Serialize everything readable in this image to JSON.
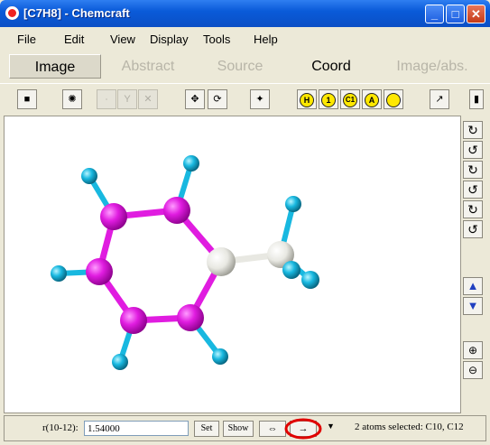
{
  "window": {
    "title": "[C7H8] - Chemcraft"
  },
  "menu": [
    "File",
    "Edit",
    "View",
    "Display",
    "Tools",
    "Help"
  ],
  "tabs": [
    {
      "label": "Image",
      "active": true,
      "selected": true
    },
    {
      "label": "Abstract",
      "active": false
    },
    {
      "label": "Source",
      "active": false
    },
    {
      "label": "Coord",
      "active": true
    },
    {
      "label": "Image/abs.",
      "active": false
    }
  ],
  "toolbar": {
    "atom_buttons": [
      "H",
      "1",
      "C1",
      "A"
    ]
  },
  "status": {
    "distance_label": "r(10-12):",
    "distance_value": "1.54000",
    "set_label": "Set",
    "show_label": "Show",
    "selection_info": "2 atoms selected: C10, C12"
  },
  "colors": {
    "carbon_ring": "#E01CE0",
    "carbon_methyl": "#E8E8E2",
    "hydrogen": "#18B8E0",
    "highlight": "#E00000"
  }
}
